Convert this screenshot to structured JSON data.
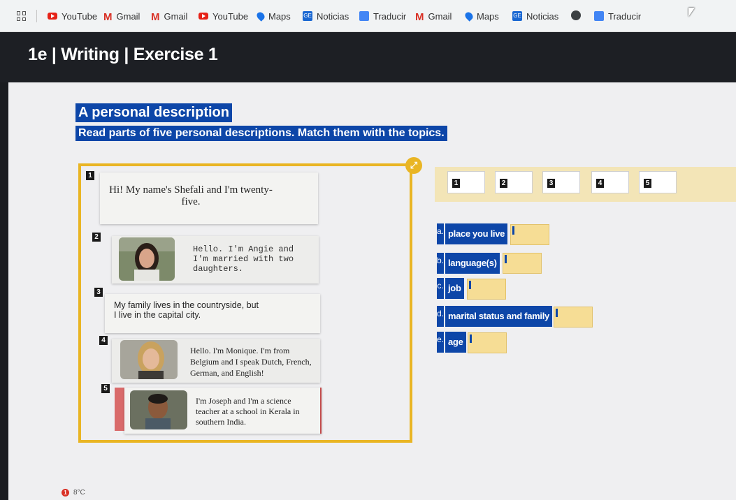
{
  "bookmarks": [
    {
      "label": "YouTube",
      "icon": "youtube-icon"
    },
    {
      "label": "Gmail",
      "icon": "gmail-icon"
    },
    {
      "label": "Gmail",
      "icon": "gmail-icon"
    },
    {
      "label": "YouTube",
      "icon": "youtube-icon"
    },
    {
      "label": "Maps",
      "icon": "maps-icon"
    },
    {
      "label": "Noticias",
      "icon": "news-icon"
    },
    {
      "label": "Traducir",
      "icon": "translate-icon"
    },
    {
      "label": "Gmail",
      "icon": "gmail-icon"
    },
    {
      "label": "Maps",
      "icon": "maps-icon"
    },
    {
      "label": "Noticias",
      "icon": "news-icon"
    },
    {
      "label": "Traducir",
      "icon": "translate-icon"
    }
  ],
  "page": {
    "title": "1e | Writing | Exercise 1"
  },
  "exercise": {
    "heading": "A personal description",
    "instruction": "Read parts of five personal descriptions. Match them with the topics.",
    "expand_icon": "expand-icon"
  },
  "descriptions": [
    {
      "number": "1",
      "text": "Hi! My name's Shefali and I'm twenty-five."
    },
    {
      "number": "2",
      "text": "Hello. I'm Angie and I'm married with two daughters."
    },
    {
      "number": "3",
      "text": "My family lives in the countryside, but I live in the capital city."
    },
    {
      "number": "4",
      "text": "Hello. I'm Monique. I'm from Belgium and I speak Dutch, French, German, and English!"
    },
    {
      "number": "5",
      "text": "I'm Joseph and I'm a science teacher at a school in Kerala in southern India."
    }
  ],
  "answer_slots": [
    "1",
    "2",
    "3",
    "4",
    "5"
  ],
  "topics": [
    {
      "letter": "a.",
      "label": "place you live"
    },
    {
      "letter": "b.",
      "label": "language(s)"
    },
    {
      "letter": "c.",
      "label": "job"
    },
    {
      "letter": "d.",
      "label": "marital status and family"
    },
    {
      "letter": "e.",
      "label": "age"
    }
  ],
  "taskbar": {
    "weather": "8°C",
    "alert": "1"
  },
  "colors": {
    "accent_blue": "#0d46a8",
    "frame_gold": "#e9b524",
    "drop_yellow": "#f6dd95",
    "answer_bar": "#f3e5b7"
  }
}
